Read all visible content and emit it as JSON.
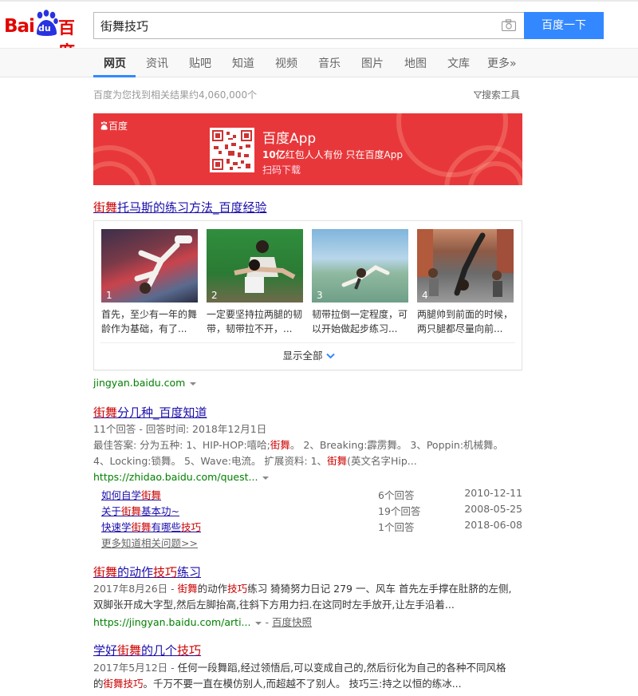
{
  "header": {
    "logo_left": "Bai",
    "logo_du": "du",
    "logo_right": "百度",
    "search_value": "街舞技巧",
    "search_button": "百度一下"
  },
  "tabs": [
    {
      "label": "网页",
      "active": true
    },
    {
      "label": "资讯"
    },
    {
      "label": "贴吧"
    },
    {
      "label": "知道"
    },
    {
      "label": "视频"
    },
    {
      "label": "音乐"
    },
    {
      "label": "图片"
    },
    {
      "label": "地图"
    },
    {
      "label": "文库"
    },
    {
      "label": "更多»"
    }
  ],
  "stats": "百度为您找到相关结果约4,060,000个",
  "search_tools": "搜索工具",
  "banner": {
    "brand": "百度",
    "title": "百度App",
    "subtitle_bold": "10亿",
    "subtitle_rest": "红包人人有份 只在百度App",
    "scan": "扫码下载"
  },
  "result1": {
    "title_hl": "街舞",
    "title_rest": "托马斯的练习方法_百度经验",
    "steps": [
      {
        "num": "1",
        "text": "首先，至少有一年的舞龄作为基础，有了..."
      },
      {
        "num": "2",
        "text": "一定要坚持拉两腿的韧带，韧带拉不开，..."
      },
      {
        "num": "3",
        "text": "韧带拉倒一定程度，可以开始做起步练习..."
      },
      {
        "num": "4",
        "text": "两腿帅到前面的时候，两只腿都尽量向前..."
      }
    ],
    "show_all": "显示全部",
    "url": "jingyan.baidu.com"
  },
  "result2": {
    "title_hl": "街舞",
    "title_rest": "分几种_百度知道",
    "meta": "11个回答 - 回答时间: 2018年12月1日",
    "line1_a": "最佳答案: 分为五种: 1、HIP-HOP:嘻哈;",
    "line1_hl": "街舞",
    "line1_b": "。 2、Breaking:霹雳舞。 3、Poppin:机械舞。",
    "line2_a": "4、Locking:锁舞。 5、Wave:电流。 扩展资料: 1、",
    "line2_hl": "街舞",
    "line2_b": "(英文名字Hip...",
    "url": "https://zhidao.baidu.com/quest...",
    "questions": [
      {
        "q_a": "如何自学",
        "q_hl": "街舞",
        "q_b": "",
        "q_hl2": "",
        "count": "6个回答",
        "date": "2010-12-11"
      },
      {
        "q_a": "关于",
        "q_hl": "街舞",
        "q_b": "基本功~",
        "q_hl2": "",
        "count": "19个回答",
        "date": "2008-05-25"
      },
      {
        "q_a": "快速学",
        "q_hl": "街舞",
        "q_b": "有哪些",
        "q_hl2": "技巧",
        "count": "1个回答",
        "date": "2018-06-08"
      }
    ],
    "more": "更多知道相关问题>>"
  },
  "result3": {
    "title_hl1": "街舞",
    "title_mid": "的动作",
    "title_hl2": "技巧",
    "title_rest": "练习",
    "date": "2017年8月26日 - ",
    "line1_hl1": "街舞",
    "line1_a": "的动作",
    "line1_hl2": "技巧",
    "line1_b": "练习 猗猗努力日记 279 一、风车 首先左手撑在肚脐的左侧,",
    "line2": "双脚张开成大字型,然后左脚抬高,往斜下方用力扫.在这同时左手放开,让左手沿着...",
    "url": "https://jingyan.baidu.com/arti...",
    "snapshot": "百度快照"
  },
  "result4": {
    "title_a": "学好",
    "title_hl1": "街舞",
    "title_mid": "的几个",
    "title_hl2": "技巧",
    "date": "2017年5月12日 - ",
    "line1": "任何一段舞蹈,经过领悟后,可以变成自己的,然后衍化为自己的各种不同风格",
    "line2_a": "的",
    "line2_hl1": "街舞",
    "line2_hl2": "技巧",
    "line2_b": "。千万不要一直在模仿别人,而超越不了别人。 技巧三:持之以恒的练冰..."
  }
}
